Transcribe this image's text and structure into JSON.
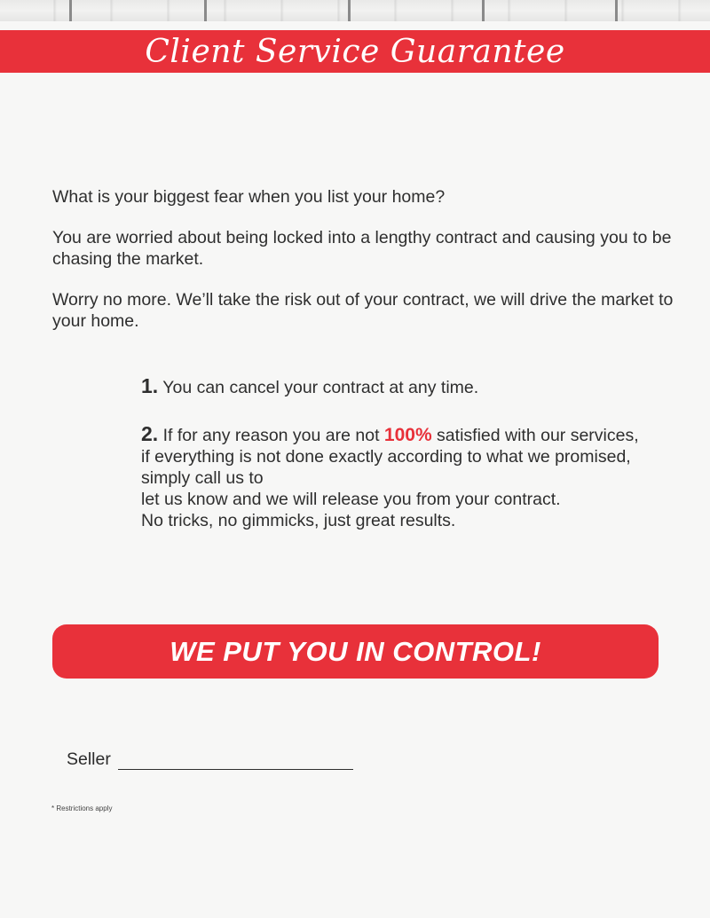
{
  "header": {
    "title": "Client Service Guarantee"
  },
  "intro": {
    "question": "What is your biggest fear when you list your home?",
    "worry": "You are worried about being locked into a lengthy contract and causing you to be chasing the market.",
    "reassurance": "Worry no more. We’ll take the risk out of your contract, we will drive the market to your home."
  },
  "promises": [
    {
      "number": "1.",
      "text": "You can cancel your contract at any time."
    },
    {
      "number": "2.",
      "text_before": "If for any reason you are not ",
      "highlight": "100%",
      "text_after": " satisfied with our services, if everything is not done exactly according to what we promised, simply call us to",
      "line2": "let us know and we will release you from your contract.",
      "line3": "No tricks, no gimmicks, just great results."
    }
  ],
  "banner": {
    "text": "WE PUT YOU IN CONTROL!"
  },
  "signature": {
    "label": "Seller"
  },
  "footnote": "* Restrictions apply",
  "colors": {
    "accent_red": "#e8313a",
    "background": "#f7f7f6",
    "text": "#2e2e2e"
  }
}
